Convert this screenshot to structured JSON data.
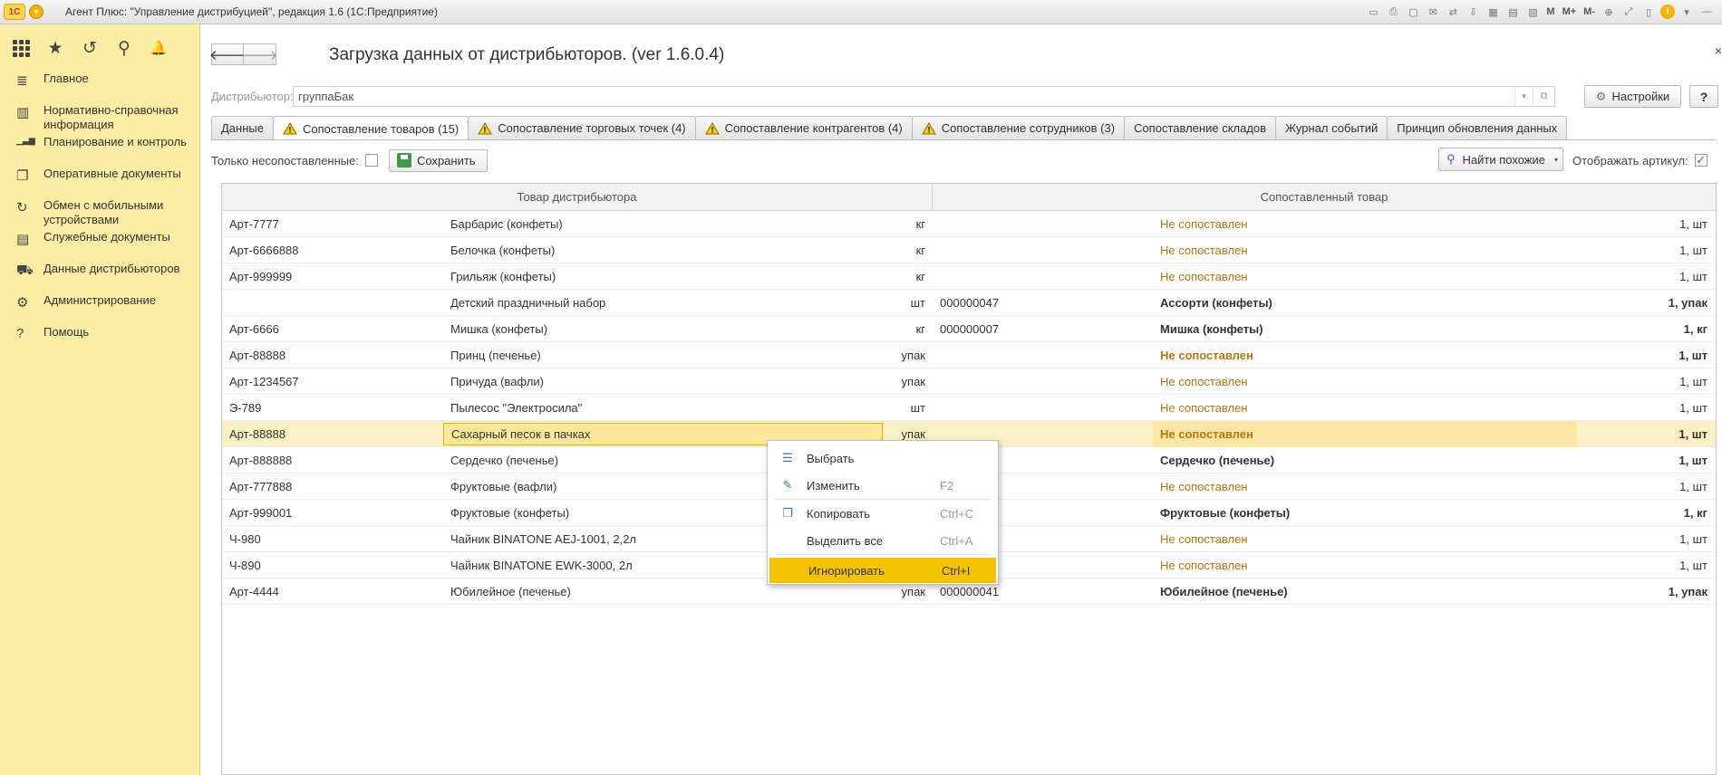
{
  "window": {
    "logo": "1С",
    "title": "Агент Плюс: \"Управление дистрибуцией\", редакция 1.6  (1С:Предприятие)",
    "tools": [
      {
        "name": "save-doc-icon",
        "glyph": "▭"
      },
      {
        "name": "print-icon",
        "glyph": "⎙"
      },
      {
        "name": "preview-icon",
        "glyph": "▢"
      },
      {
        "name": "attach-icon",
        "glyph": "✉"
      },
      {
        "name": "link-icon",
        "glyph": "⇄"
      },
      {
        "name": "download-icon",
        "glyph": "⇩"
      },
      {
        "name": "calculator-icon",
        "glyph": "▦"
      },
      {
        "name": "calendar-icon",
        "glyph": "▤"
      },
      {
        "name": "table-icon",
        "glyph": "▧"
      },
      {
        "name": "memory-m-button",
        "text": "M"
      },
      {
        "name": "memory-mplus-button",
        "text": "M+"
      },
      {
        "name": "memory-mminus-button",
        "text": "M-"
      },
      {
        "name": "zoom-icon",
        "glyph": "⊕"
      },
      {
        "name": "fullscreen-icon",
        "glyph": "⤢"
      },
      {
        "name": "panel-icon",
        "glyph": "▯"
      }
    ],
    "info_icon": "i",
    "info_caret": "▾",
    "minimize": "—"
  },
  "sidebar": {
    "quick": [
      {
        "name": "apps-grid-icon"
      },
      {
        "name": "favorites-star-icon",
        "glyph": "★"
      },
      {
        "name": "history-icon",
        "glyph": "↺"
      },
      {
        "name": "search-icon",
        "glyph": "⚲"
      },
      {
        "name": "notifications-bell-icon",
        "glyph": "🔔"
      }
    ],
    "items": [
      {
        "id": "main",
        "icon": "menu-lines-icon",
        "glyph": "≣",
        "label": "Главное"
      },
      {
        "id": "nsi",
        "icon": "reference-table-icon",
        "glyph": "▥",
        "label": "Нормативно-справочная информация"
      },
      {
        "id": "planning",
        "icon": "bar-chart-icon",
        "glyph": "▁▃▆",
        "label": "Планирование и контроль"
      },
      {
        "id": "operative",
        "icon": "documents-icon",
        "glyph": "❐",
        "label": "Оперативные документы"
      },
      {
        "id": "mobile",
        "icon": "sync-icon",
        "glyph": "↻",
        "label": "Обмен с мобильными устройствами"
      },
      {
        "id": "service",
        "icon": "service-docs-icon",
        "glyph": "▤",
        "label": "Служебные документы"
      },
      {
        "id": "distributors",
        "icon": "distributors-icon",
        "glyph": "⛟",
        "label": "Данные дистрибьюторов"
      },
      {
        "id": "admin",
        "icon": "gear-icon",
        "glyph": "⚙",
        "label": "Администрирование"
      },
      {
        "id": "help",
        "icon": "question-icon",
        "glyph": "?",
        "label": "Помощь"
      }
    ]
  },
  "header": {
    "back": "🡐",
    "forward": "🡒",
    "title": "Загрузка данных от дистрибьюторов. (ver 1.6.0.4)",
    "close": "×"
  },
  "distributor": {
    "label": "Дистрибьютор:",
    "value": "группаБак",
    "dropdown": "▾",
    "open": "⧉"
  },
  "buttons": {
    "settings": "Настройки",
    "settings_icon": "⚙",
    "help": "?",
    "save": "Сохранить",
    "find_similar": "Найти похожие",
    "find_icon": "⚲",
    "find_caret": "▾"
  },
  "tabs": [
    {
      "label": "Данные",
      "warning": false,
      "active": false
    },
    {
      "label": "Сопоставление товаров (15)",
      "warning": true,
      "active": true
    },
    {
      "label": "Сопоставление торговых точек (4)",
      "warning": true,
      "active": false
    },
    {
      "label": "Сопоставление контрагентов (4)",
      "warning": true,
      "active": false
    },
    {
      "label": "Сопоставление сотрудников (3)",
      "warning": true,
      "active": false
    },
    {
      "label": "Сопоставление складов",
      "warning": false,
      "active": false
    },
    {
      "label": "Журнал событий",
      "warning": false,
      "active": false
    },
    {
      "label": "Принцип обновления данных",
      "warning": false,
      "active": false
    }
  ],
  "filters": {
    "only_unmatched_label": "Только несопоставленные:",
    "only_unmatched_checked": false,
    "show_article_label": "Отображать артикул:",
    "show_article_checked": true,
    "check_mark": "✓"
  },
  "table": {
    "columns": [
      "Товар дистрибьютора",
      "Сопоставленный товар"
    ],
    "rows": [
      {
        "art": "Арт-7777",
        "name": "Барбарис (конфеты)",
        "unit": "кг",
        "code": "",
        "matched": "Не сопоставлен",
        "qty": "1, шт",
        "bold": false,
        "matched_ok": false
      },
      {
        "art": "Арт-6666888",
        "name": "Белочка (конфеты)",
        "unit": "кг",
        "code": "",
        "matched": "Не сопоставлен",
        "qty": "1, шт",
        "bold": false,
        "matched_ok": false
      },
      {
        "art": "Арт-999999",
        "name": "Грильяж (конфеты)",
        "unit": "кг",
        "code": "",
        "matched": "Не сопоставлен",
        "qty": "1, шт",
        "bold": false,
        "matched_ok": false
      },
      {
        "art": "",
        "name": "Детский праздничный набор",
        "unit": "шт",
        "code": "000000047",
        "matched": "Ассорти (конфеты)",
        "qty": "1, упак",
        "bold": true,
        "matched_ok": true
      },
      {
        "art": "Арт-6666",
        "name": "Мишка (конфеты)",
        "unit": "кг",
        "code": "000000007",
        "matched": "Мишка (конфеты)",
        "qty": "1, кг",
        "bold": true,
        "matched_ok": true
      },
      {
        "art": "Арт-88888",
        "name": "Принц (печенье)",
        "unit": "упак",
        "code": "",
        "matched": "Не сопоставлен",
        "qty": "1, шт",
        "bold": true,
        "matched_ok": false
      },
      {
        "art": "Арт-1234567",
        "name": "Причуда (вафли)",
        "unit": "упак",
        "code": "",
        "matched": "Не сопоставлен",
        "qty": "1, шт",
        "bold": false,
        "matched_ok": false
      },
      {
        "art": "Э-789",
        "name": "Пылесос \"Электросила\"",
        "unit": "шт",
        "code": "",
        "matched": "Не сопоставлен",
        "qty": "1, шт",
        "bold": false,
        "matched_ok": false
      },
      {
        "art": "Арт-88888",
        "name": "Сахарный песок в пачках",
        "unit": "упак",
        "code": "",
        "matched": "Не сопоставлен",
        "qty": "1, шт",
        "bold": true,
        "matched_ok": false,
        "selected": true
      },
      {
        "art": "Арт-888888",
        "name": "Сердечко (печенье)",
        "unit": "",
        "code": "",
        "matched": "Сердечко (печенье)",
        "qty": "1, шт",
        "bold": true,
        "matched_ok": true
      },
      {
        "art": "Арт-777888",
        "name": "Фруктовые (вафли)",
        "unit": "",
        "code": "",
        "matched": "Не сопоставлен",
        "qty": "1, шт",
        "bold": false,
        "matched_ok": false
      },
      {
        "art": "Арт-999001",
        "name": "Фруктовые (конфеты)",
        "unit": "",
        "code": "",
        "matched": "Фруктовые (конфеты)",
        "qty": "1, кг",
        "bold": true,
        "matched_ok": true
      },
      {
        "art": "Ч-980",
        "name": "Чайник BINATONE  AEJ-1001,  2,2л",
        "unit": "",
        "code": "",
        "matched": "Не сопоставлен",
        "qty": "1, шт",
        "bold": false,
        "matched_ok": false
      },
      {
        "art": "Ч-890",
        "name": "Чайник BINATONE  EWK-3000,  2л",
        "unit": "",
        "code": "",
        "matched": "Не сопоставлен",
        "qty": "1, шт",
        "bold": false,
        "matched_ok": false
      },
      {
        "art": "Арт-4444",
        "name": "Юбилейное (печенье)",
        "unit": "упак",
        "code": "000000041",
        "matched": "Юбилейное (печенье)",
        "qty": "1, упак",
        "bold": true,
        "matched_ok": true
      }
    ]
  },
  "context_menu": {
    "items": [
      {
        "id": "select",
        "icon": "select-icon",
        "glyph": "☰",
        "label": "Выбрать",
        "key": ""
      },
      {
        "id": "edit",
        "icon": "pencil-icon",
        "glyph": "✎",
        "label": "Изменить",
        "key": "F2"
      },
      {
        "id": "copy",
        "icon": "copy-icon",
        "glyph": "❐",
        "label": "Копировать",
        "key": "Ctrl+C"
      },
      {
        "id": "select-all",
        "icon": "",
        "glyph": "",
        "label": "Выделить все",
        "key": "Ctrl+A"
      },
      {
        "id": "ignore",
        "icon": "",
        "glyph": "",
        "label": "Игнорировать",
        "key": "Ctrl+I",
        "active": true
      }
    ]
  },
  "colors": {
    "sidebar_bg": "#fbeea4",
    "not_matched": "#b5760d",
    "menu_highlight": "#f5c300",
    "selected_row": "#fcf1c4"
  }
}
